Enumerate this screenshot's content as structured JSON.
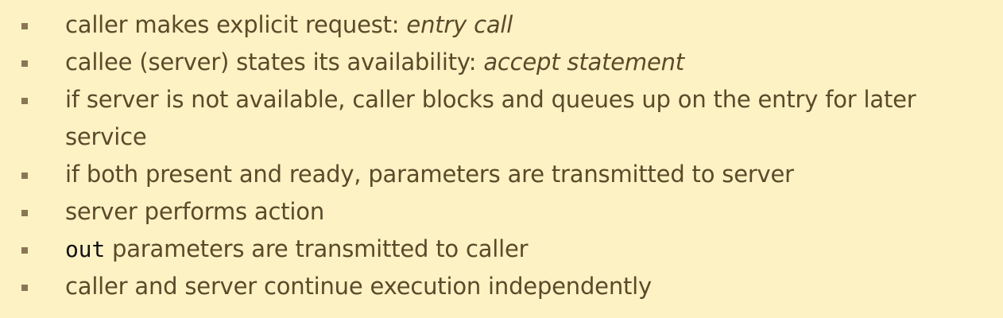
{
  "bullets": [
    {
      "text": "caller makes explicit request:",
      "emphasis": "entry call"
    },
    {
      "text": "callee (server) states its availability:",
      "emphasis": "accept statement"
    },
    {
      "text": "if server is not available, caller blocks and queues up on the entry for later service"
    },
    {
      "text": "if both present and ready, parameters are transmitted to server"
    },
    {
      "text": "server performs action"
    },
    {
      "code": "out",
      "text": "parameters are transmitted to caller"
    },
    {
      "text": "caller and server continue execution independently"
    }
  ],
  "colors": {
    "background": "#fcf2c4",
    "text": "#5a4a2a",
    "bullet": "#8a7654",
    "code": "#111111"
  }
}
